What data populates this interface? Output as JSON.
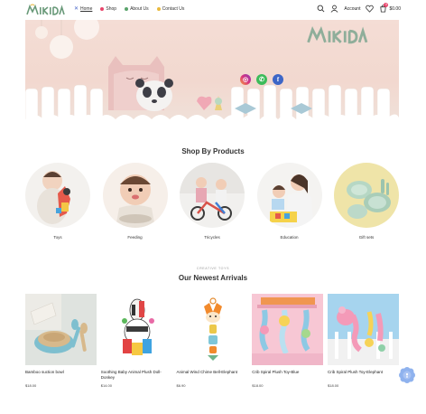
{
  "brand": {
    "name": "MIKIDA"
  },
  "nav": [
    {
      "label": "Home",
      "dot": "#4a67c9"
    },
    {
      "label": "Shop",
      "dot": "#e8446b"
    },
    {
      "label": "About Us",
      "dot": "#5aa36b"
    },
    {
      "label": "Contact Us",
      "dot": "#e9b93c"
    }
  ],
  "header": {
    "account_label": "Account",
    "cart_count": "0",
    "cart_total": "$0.00"
  },
  "hero": {
    "brand_text": "MIKIDA"
  },
  "sections": {
    "shop_by_products": "Shop By Products",
    "newest_subtitle": "CREATIVE TOYS",
    "newest_title": "Our Newest Arrivals"
  },
  "categories": [
    {
      "label": "Toys"
    },
    {
      "label": "Feeding"
    },
    {
      "label": "Tricycles"
    },
    {
      "label": "Education"
    },
    {
      "label": "Gift sets"
    }
  ],
  "products": [
    {
      "name": "Bamboo suction bowl",
      "price": "$18.00"
    },
    {
      "name": "Soothing Baby Animal Plush Doll- Donkey",
      "price": "$14.00"
    },
    {
      "name": "Animal Wind Chime Bell-Elephant",
      "price": "$6.90"
    },
    {
      "name": "Crib Spiral Plush Toy-Blue",
      "price": "$18.00"
    },
    {
      "name": "Crib Spiral Plush Toy-Elephant",
      "price": "$18.00"
    }
  ],
  "colors": {
    "accent": "#6a9a7a",
    "badge": "#e8446b",
    "chat": "#8fb2ee"
  }
}
